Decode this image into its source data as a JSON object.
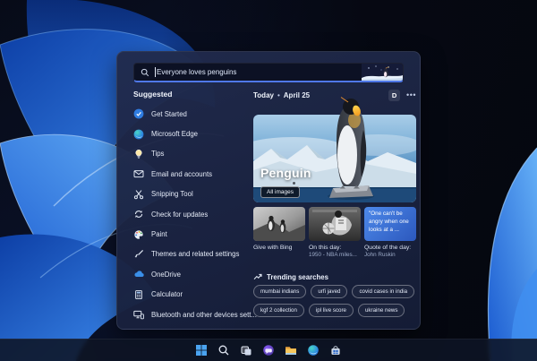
{
  "colors": {
    "accent": "#4f78e8",
    "panel_bg": "#1d2948",
    "search_bg": "#0c1124",
    "quote_card": "#3b6fd4",
    "wallpaper_blue": "#2f7de0"
  },
  "search_panel": {
    "search": {
      "value": "Everyone loves penguins",
      "icon": "search-icon"
    },
    "suggested": {
      "title": "Suggested",
      "items": [
        {
          "label": "Get Started",
          "icon": "get-started-icon"
        },
        {
          "label": "Microsoft Edge",
          "icon": "edge-icon"
        },
        {
          "label": "Tips",
          "icon": "tips-icon"
        },
        {
          "label": "Email and accounts",
          "icon": "email-icon"
        },
        {
          "label": "Snipping Tool",
          "icon": "snipping-tool-icon"
        },
        {
          "label": "Check for updates",
          "icon": "updates-icon"
        },
        {
          "label": "Paint",
          "icon": "paint-icon"
        },
        {
          "label": "Themes and related settings",
          "icon": "themes-icon"
        },
        {
          "label": "OneDrive",
          "icon": "onedrive-icon"
        },
        {
          "label": "Calculator",
          "icon": "calculator-icon"
        },
        {
          "label": "Bluetooth and other devices sett...",
          "icon": "bluetooth-icon"
        }
      ]
    },
    "today": {
      "label": "Today",
      "separator": "•",
      "date": "April 25",
      "profile_initial": "D",
      "more": "•••"
    },
    "hero": {
      "title": "Penguin",
      "button_label": "All images"
    },
    "cards": [
      {
        "caption": "Give with Bing"
      },
      {
        "caption": "On this day:",
        "subcaption": "1950 - NBA miles..."
      },
      {
        "quote": "\"One can't be angry when one looks at a ...",
        "caption": "Quote of the day:",
        "subcaption": "John Ruskin"
      }
    ],
    "trending": {
      "title": "Trending searches",
      "pills": [
        "mumbai indians",
        "urfi javed",
        "covid cases in india",
        "kgf 2 collection",
        "ipl live score",
        "ukraine news"
      ]
    }
  },
  "taskbar": {
    "icons": [
      "Start",
      "Search",
      "Task view",
      "Chat",
      "File Explorer",
      "Microsoft Edge",
      "Microsoft Store"
    ]
  }
}
